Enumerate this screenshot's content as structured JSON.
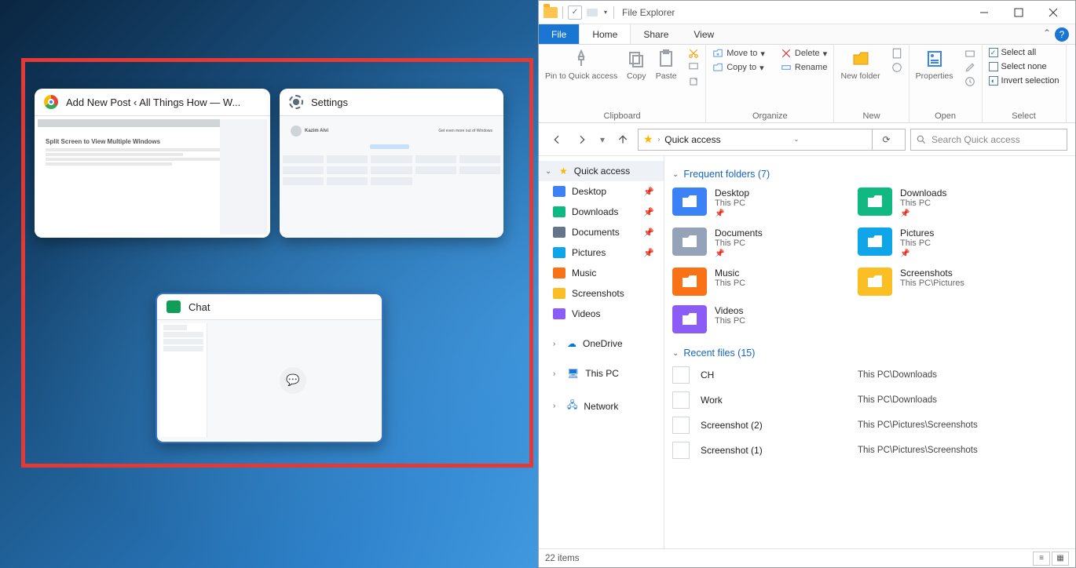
{
  "snapCards": {
    "chrome": {
      "title": "Add New Post ‹ All Things How — W...",
      "editorHeading": "Split Screen to View Multiple Windows"
    },
    "settings": {
      "title": "Settings",
      "userName": "Kazim Alvi",
      "banner": "Get even more out of Windows"
    },
    "chat": {
      "title": "Chat"
    }
  },
  "fileExplorer": {
    "windowTitle": "File Explorer",
    "tabs": {
      "file": "File",
      "home": "Home",
      "share": "Share",
      "view": "View"
    },
    "ribbon": {
      "clipboard": {
        "pin": "Pin to Quick access",
        "copy": "Copy",
        "paste": "Paste",
        "label": "Clipboard"
      },
      "organize": {
        "moveTo": "Move to",
        "copyTo": "Copy to",
        "delete": "Delete",
        "rename": "Rename",
        "label": "Organize"
      },
      "new": {
        "newFolder": "New folder",
        "label": "New"
      },
      "open": {
        "properties": "Properties",
        "label": "Open"
      },
      "select": {
        "selectAll": "Select all",
        "selectNone": "Select none",
        "invert": "Invert selection",
        "label": "Select"
      }
    },
    "address": {
      "location": "Quick access",
      "searchPlaceholder": "Search Quick access"
    },
    "nav": {
      "quickAccess": "Quick access",
      "items": [
        {
          "label": "Desktop",
          "pinned": true
        },
        {
          "label": "Downloads",
          "pinned": true
        },
        {
          "label": "Documents",
          "pinned": true
        },
        {
          "label": "Pictures",
          "pinned": true
        },
        {
          "label": "Music",
          "pinned": false
        },
        {
          "label": "Screenshots",
          "pinned": false
        },
        {
          "label": "Videos",
          "pinned": false
        }
      ],
      "oneDrive": "OneDrive",
      "thisPC": "This PC",
      "network": "Network"
    },
    "frequent": {
      "heading": "Frequent folders (7)",
      "items": [
        {
          "name": "Desktop",
          "loc": "This PC",
          "pinned": true,
          "color": "fi-blue"
        },
        {
          "name": "Downloads",
          "loc": "This PC",
          "pinned": true,
          "color": "fi-teal"
        },
        {
          "name": "Documents",
          "loc": "This PC",
          "pinned": true,
          "color": "fi-gray"
        },
        {
          "name": "Pictures",
          "loc": "This PC",
          "pinned": true,
          "color": "fi-cyan"
        },
        {
          "name": "Music",
          "loc": "This PC",
          "pinned": false,
          "color": "fi-orange"
        },
        {
          "name": "Screenshots",
          "loc": "This PC\\Pictures",
          "pinned": false,
          "color": "fi-yellow"
        },
        {
          "name": "Videos",
          "loc": "This PC",
          "pinned": false,
          "color": "fi-purple"
        }
      ]
    },
    "recent": {
      "heading": "Recent files (15)",
      "items": [
        {
          "name": "CH",
          "path": "This PC\\Downloads"
        },
        {
          "name": "Work",
          "path": "This PC\\Downloads"
        },
        {
          "name": "Screenshot (2)",
          "path": "This PC\\Pictures\\Screenshots"
        },
        {
          "name": "Screenshot (1)",
          "path": "This PC\\Pictures\\Screenshots"
        }
      ]
    },
    "status": "22 items"
  }
}
